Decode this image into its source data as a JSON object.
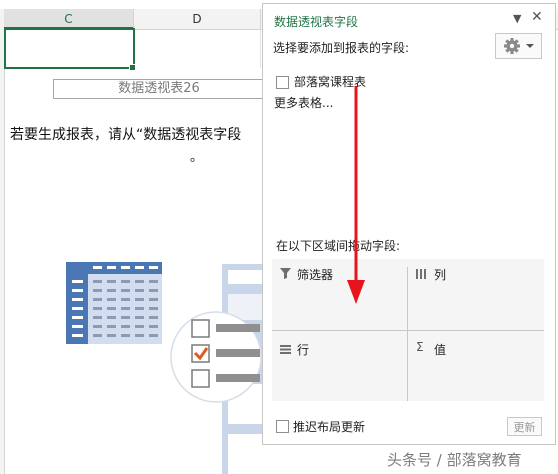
{
  "sheet": {
    "col_c": "C",
    "col_d": "D",
    "pivot_title": "数据透视表26",
    "instruction_line1": "若要生成报表，请从“数据透视表字段",
    "instruction_line2": "。"
  },
  "pane": {
    "title": "数据透视表字段",
    "choose_label": "选择要添加到报表的字段:",
    "fields": [
      {
        "label": "部落窝课程表",
        "checked": false
      }
    ],
    "more_tables": "更多表格...",
    "drag_label": "在以下区域间拖动字段:",
    "areas": {
      "filter": "筛选器",
      "columns": "列",
      "rows": "行",
      "values": "值"
    },
    "defer_label": "推迟布局更新",
    "update_label": "更新",
    "icons": {
      "filter": "funnel-icon",
      "columns": "columns-icon",
      "rows": "rows-icon",
      "values": "sigma-icon",
      "gear": "gear-icon",
      "close": "close-icon",
      "dropdown": "chevron-down-icon"
    }
  },
  "watermark": "头条号 / 部落窝教育",
  "colors": {
    "accent_green": "#217346",
    "arrow_red": "#e8141b",
    "illus_blue": "#4b78b4",
    "check_orange": "#e05a26"
  }
}
